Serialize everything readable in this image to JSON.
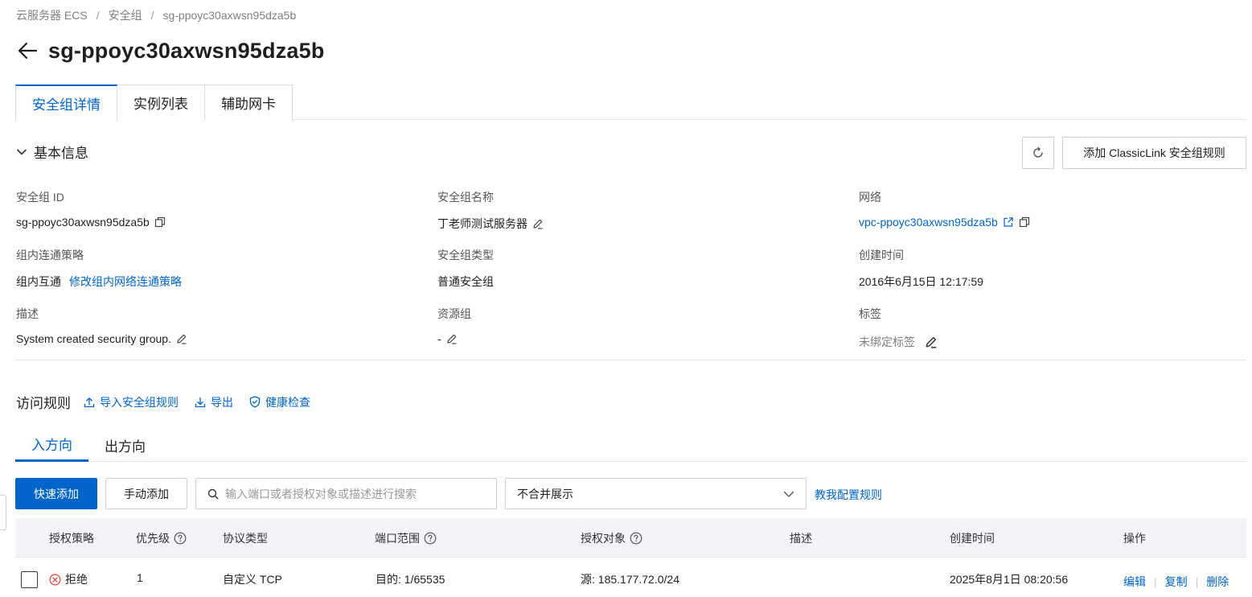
{
  "breadcrumb": [
    "云服务器 ECS",
    "安全组",
    "sg-ppoyc30axwsn95dza5b"
  ],
  "breadcrumb_sep": "/",
  "page_title": "sg-ppoyc30axwsn95dza5b",
  "tabs": [
    {
      "label": "安全组详情",
      "active": true
    },
    {
      "label": "实例列表",
      "active": false
    },
    {
      "label": "辅助网卡",
      "active": false
    }
  ],
  "basic_info": {
    "title": "基本信息",
    "add_classiclink_label": "添加 ClassicLink 安全组规则",
    "fields": {
      "sg_id": {
        "label": "安全组 ID",
        "value": "sg-ppoyc30axwsn95dza5b"
      },
      "sg_name": {
        "label": "安全组名称",
        "value": "丁老师测试服务器"
      },
      "network": {
        "label": "网络",
        "value": "vpc-ppoyc30axwsn95dza5b"
      },
      "policy": {
        "label": "组内连通策略",
        "value": "组内互通",
        "link": "修改组内网络连通策略"
      },
      "sg_type": {
        "label": "安全组类型",
        "value": "普通安全组"
      },
      "created": {
        "label": "创建时间",
        "value": "2016年6月15日 12:17:59"
      },
      "description": {
        "label": "描述",
        "value": "System created security group."
      },
      "resource_group": {
        "label": "资源组",
        "value": "-"
      },
      "tags": {
        "label": "标签",
        "value": "未绑定标签"
      }
    }
  },
  "rules": {
    "title": "访问规则",
    "actions": {
      "import": "导入安全组规则",
      "export": "导出",
      "health": "健康检查"
    },
    "direction_tabs": [
      {
        "label": "入方向",
        "active": true
      },
      {
        "label": "出方向",
        "active": false
      }
    ],
    "quick_add": "快速添加",
    "manual_add": "手动添加",
    "search_placeholder": "输入端口或者授权对象或描述进行搜索",
    "merge_select": "不合并展示",
    "help_link": "教我配置规则",
    "columns": {
      "policy": "授权策略",
      "priority": "优先级",
      "protocol": "协议类型",
      "port": "端口范围",
      "target": "授权对象",
      "desc": "描述",
      "created": "创建时间",
      "ops": "操作"
    },
    "rows": [
      {
        "policy": "拒绝",
        "priority": "1",
        "protocol": "自定义 TCP",
        "port": "目的: 1/65535",
        "target": "源: 185.177.72.0/24",
        "desc": "",
        "created": "2025年8月1日 08:20:56",
        "ops": {
          "edit": "编辑",
          "copy": "复制",
          "delete": "删除"
        }
      }
    ]
  },
  "colors": {
    "accent": "#0064c8",
    "danger": "#e0403b",
    "text": "#1f1f1f",
    "muted": "#808080"
  }
}
